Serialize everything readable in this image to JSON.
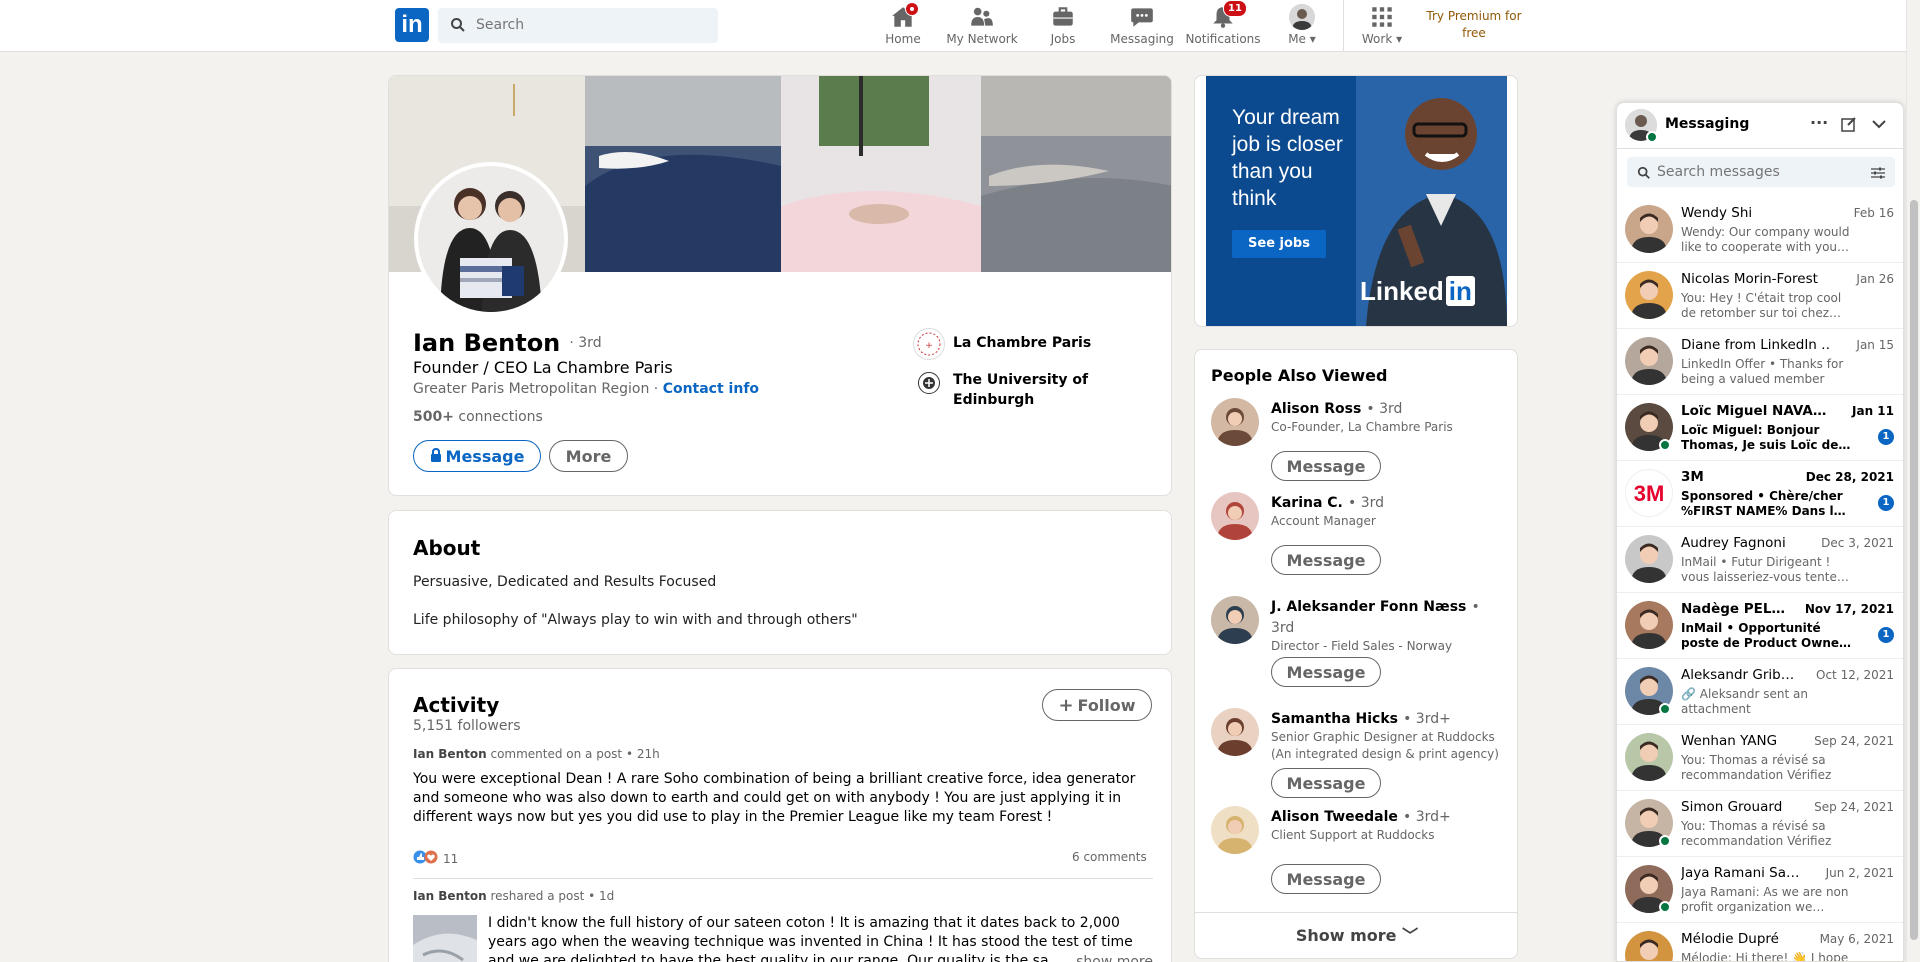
{
  "nav": {
    "logo": "in",
    "search_placeholder": "Search",
    "items": [
      {
        "label": "Home"
      },
      {
        "label": "My Network"
      },
      {
        "label": "Jobs"
      },
      {
        "label": "Messaging"
      },
      {
        "label": "Notifications",
        "badge": "11"
      },
      {
        "label": "Me"
      },
      {
        "label": "Work"
      }
    ],
    "premium": "Try Premium for free"
  },
  "profile": {
    "name": "Ian Benton",
    "degree": "· 3rd",
    "headline": "Founder / CEO La Chambre Paris",
    "location": "Greater Paris Metropolitan Region",
    "separator": "·",
    "contact_info": "Contact info",
    "connections_count": "500+",
    "connections_label": "connections",
    "message_button": "Message",
    "more_button": "More",
    "company": "La Chambre Paris",
    "school": "The University of Edinburgh"
  },
  "about": {
    "title": "About",
    "line1": "Persuasive, Dedicated and Results Focused",
    "line2": "Life philosophy of \"Always play to win with and through others\""
  },
  "activity": {
    "title": "Activity",
    "followers": "5,151 followers",
    "follow_button": "Follow",
    "post1": {
      "author": "Ian Benton",
      "action": "commented on a post • 21h",
      "text": "You were exceptional Dean ! A rare Soho combination of being a brilliant creative force, idea generator and someone who was also down to earth and could get on with anybody ! You are just applying it in different ways now but yes you did use to play in the Premier League like my team Forest !",
      "reactions": "11",
      "comments": "6 comments"
    },
    "post2": {
      "author": "Ian Benton",
      "action": "reshared a post • 1d",
      "text": "I didn't know the full history of our sateen coton ! It is amazing that it dates back to 2,000 years ago when the weaving technique was invented in China ! It has stood the test of time and we are delighted to have the best quality in our range. Our quality is the sa…",
      "show_more": "…show more"
    }
  },
  "ad": {
    "headline": "Your dream job is closer than you think",
    "cta": "See jobs",
    "brand": "Linked",
    "brand_in": "in"
  },
  "people_also_viewed": {
    "title": "People Also Viewed",
    "message_label": "Message",
    "show_more": "Show more",
    "people": [
      {
        "name": "Alison Ross",
        "degree": "• 3rd",
        "headline": "Co-Founder, La Chambre Paris"
      },
      {
        "name": "Karina C.",
        "degree": "• 3rd",
        "headline": "Account Manager"
      },
      {
        "name": "J. Aleksander Fonn Næss",
        "degree": "• 3rd",
        "headline": "Director - Field Sales - Norway"
      },
      {
        "name": "Samantha Hicks",
        "degree": "• 3rd+",
        "headline": "Senior Graphic Designer at Ruddocks (An integrated design & print agency)"
      },
      {
        "name": "Alison Tweedale",
        "degree": "• 3rd+",
        "headline": "Client Support at Ruddocks"
      }
    ]
  },
  "messaging": {
    "title": "Messaging",
    "search_placeholder": "Search messages",
    "conversations": [
      {
        "name": "Wendy Shi",
        "date": "Feb 16",
        "preview": "Wendy: Our company would like to cooperate with you…"
      },
      {
        "name": "Nicolas Morin-Forest",
        "date": "Jan 26",
        "preview": "You: Hey ! C'était trop cool de retomber sur toi chez…"
      },
      {
        "name": "Diane from LinkedIn …",
        "date": "Jan 15",
        "preview": "LinkedIn Offer • Thanks for being a valued member"
      },
      {
        "name": "Loïc Miguel NAVA…",
        "date": "Jan 11",
        "preview": "Loïc Miguel: Bonjour Thomas, Je suis Loïc de…",
        "unread": "1"
      },
      {
        "name": "3M",
        "date": "Dec 28, 2021",
        "preview": "Sponsored • Chère/cher %FIRST NAME% Dans l…",
        "unread": "1"
      },
      {
        "name": "Audrey Fagnoni",
        "date": "Dec 3, 2021",
        "preview": "InMail • Futur Dirigeant ! vous laisseriez-vous tente…"
      },
      {
        "name": "Nadège PEL…",
        "date": "Nov 17, 2021",
        "preview": "InMail • Opportunité poste de Product Owne…",
        "unread": "1"
      },
      {
        "name": "Aleksandr Grib…",
        "date": "Oct 12, 2021",
        "preview": "Aleksandr sent an attachment"
      },
      {
        "name": "Wenhan YANG",
        "date": "Sep 24, 2021",
        "preview": "You: Thomas a révisé sa recommandation Vérifiez la…"
      },
      {
        "name": "Simon Grouard",
        "date": "Sep 24, 2021",
        "preview": "You: Thomas a révisé sa recommandation Vérifiez la…"
      },
      {
        "name": "Jaya Ramani Sa…",
        "date": "Jun 2, 2021",
        "preview": "Jaya Ramani: As we are non profit organization we…"
      },
      {
        "name": "Mélodie Dupré",
        "date": "May 6, 2021",
        "preview": "Mélodie: Hi there! 👋 I hope"
      }
    ]
  }
}
